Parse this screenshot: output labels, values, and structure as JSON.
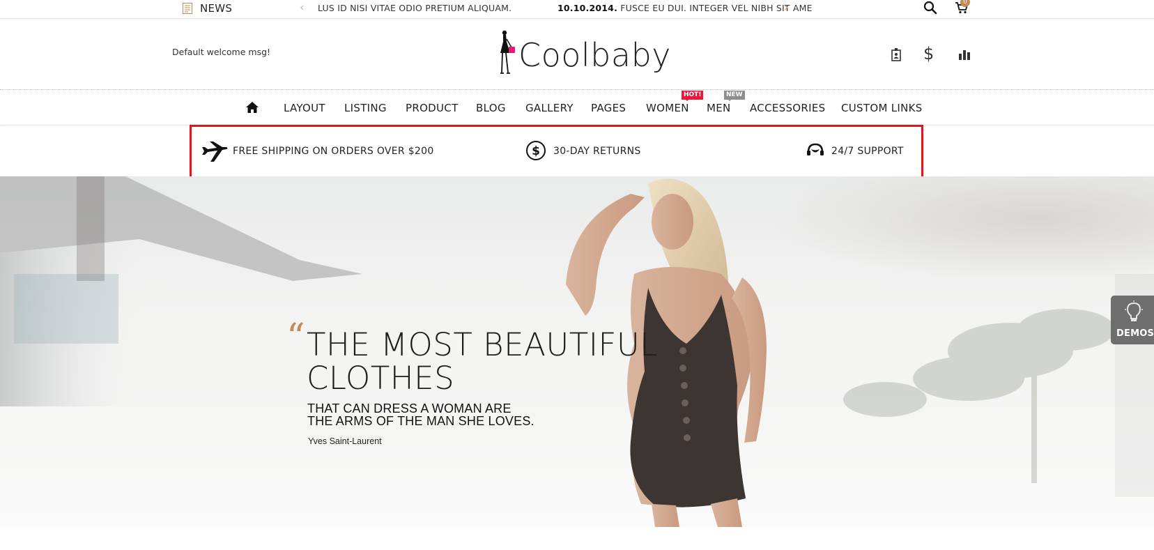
{
  "topbar": {
    "news_label": "NEWS",
    "news_items": [
      "LUS ID NISI VITAE ODIO PRETIUM ALIQUAM.",
      {
        "date": "10.10.2014.",
        "text": "FUSCE EU DUI. INTEGER VEL NIBH SIT AME"
      }
    ],
    "cart_count": "0"
  },
  "header": {
    "welcome": "Default welcome msg!",
    "logo_text": "Coolbaby",
    "currency_symbol": "$"
  },
  "nav": {
    "items": [
      "LAYOUT",
      "LISTING",
      "PRODUCT",
      "BLOG",
      "GALLERY",
      "PAGES",
      "WOMEN",
      "MEN",
      "ACCESSORIES",
      "CUSTOM LINKS"
    ],
    "badges": {
      "women": "HOT!",
      "men": "NEW"
    }
  },
  "policy": {
    "items": [
      {
        "icon": "airplane-icon",
        "text": "FREE SHIPPING ON ORDERS OVER $200"
      },
      {
        "icon": "dollar-circle-icon",
        "text": "30-DAY RETURNS"
      },
      {
        "icon": "headset-icon",
        "text": "24/7 SUPPORT"
      }
    ],
    "highlight_color": "#e8111d"
  },
  "hero": {
    "title": "THE MOST BEAUTIFUL CLOTHES",
    "subtitle_line1": "THAT CAN DRESS A WOMAN ARE",
    "subtitle_line2": "THE ARMS OF THE MAN SHE LOVES.",
    "author": "Yves Saint-Laurent"
  },
  "demos": {
    "label": "DEMOS"
  },
  "colors": {
    "accent": "#c48a55",
    "hot": "#e8193c",
    "new": "#8d8d8d"
  }
}
